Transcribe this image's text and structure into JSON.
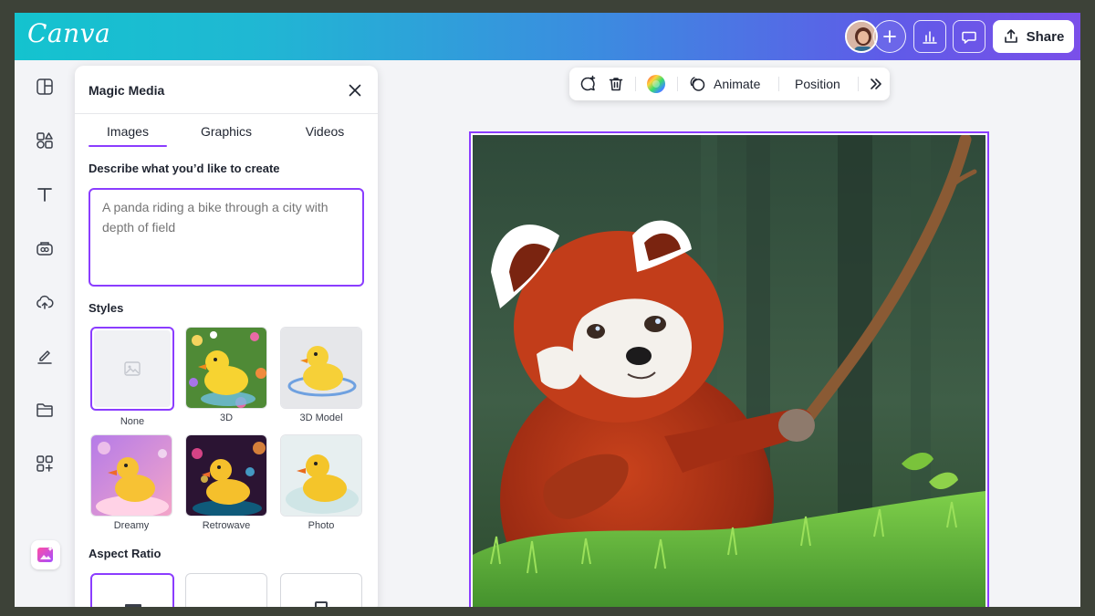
{
  "app": {
    "logo": "Canva"
  },
  "topbar": {
    "share_label": "Share"
  },
  "toolbar": {
    "animate_label": "Animate",
    "position_label": "Position"
  },
  "panel": {
    "title": "Magic Media",
    "tabs": [
      {
        "label": "Images",
        "active": true
      },
      {
        "label": "Graphics",
        "active": false
      },
      {
        "label": "Videos",
        "active": false
      }
    ],
    "prompt_label": "Describe what you’d like to create",
    "prompt_placeholder": "A panda riding a bike through a city with depth of field",
    "styles_label": "Styles",
    "styles": [
      {
        "label": "None",
        "selected": true
      },
      {
        "label": "3D",
        "selected": false
      },
      {
        "label": "3D Model",
        "selected": false
      },
      {
        "label": "Dreamy",
        "selected": false
      },
      {
        "label": "Retrowave",
        "selected": false
      },
      {
        "label": "Photo",
        "selected": false
      }
    ],
    "aspect_label": "Aspect Ratio"
  },
  "colors": {
    "accent": "#8b3dff",
    "topbar_start": "#14c3cf",
    "topbar_end": "#7a4fe9"
  }
}
